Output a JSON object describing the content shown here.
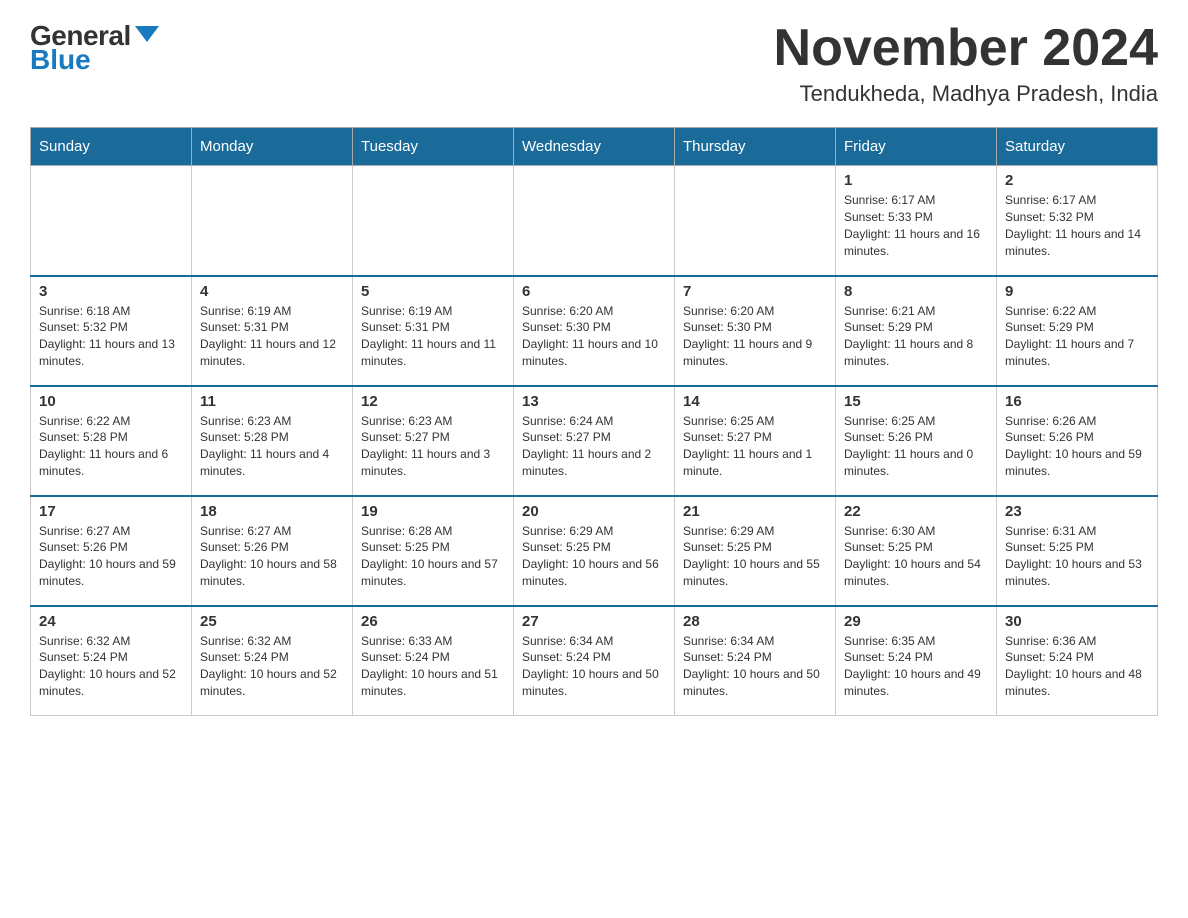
{
  "logo": {
    "general": "General",
    "blue": "Blue"
  },
  "header": {
    "month_year": "November 2024",
    "location": "Tendukheda, Madhya Pradesh, India"
  },
  "weekdays": [
    "Sunday",
    "Monday",
    "Tuesday",
    "Wednesday",
    "Thursday",
    "Friday",
    "Saturday"
  ],
  "weeks": [
    [
      {
        "day": "",
        "sunrise": "",
        "sunset": "",
        "daylight": ""
      },
      {
        "day": "",
        "sunrise": "",
        "sunset": "",
        "daylight": ""
      },
      {
        "day": "",
        "sunrise": "",
        "sunset": "",
        "daylight": ""
      },
      {
        "day": "",
        "sunrise": "",
        "sunset": "",
        "daylight": ""
      },
      {
        "day": "",
        "sunrise": "",
        "sunset": "",
        "daylight": ""
      },
      {
        "day": "1",
        "sunrise": "Sunrise: 6:17 AM",
        "sunset": "Sunset: 5:33 PM",
        "daylight": "Daylight: 11 hours and 16 minutes."
      },
      {
        "day": "2",
        "sunrise": "Sunrise: 6:17 AM",
        "sunset": "Sunset: 5:32 PM",
        "daylight": "Daylight: 11 hours and 14 minutes."
      }
    ],
    [
      {
        "day": "3",
        "sunrise": "Sunrise: 6:18 AM",
        "sunset": "Sunset: 5:32 PM",
        "daylight": "Daylight: 11 hours and 13 minutes."
      },
      {
        "day": "4",
        "sunrise": "Sunrise: 6:19 AM",
        "sunset": "Sunset: 5:31 PM",
        "daylight": "Daylight: 11 hours and 12 minutes."
      },
      {
        "day": "5",
        "sunrise": "Sunrise: 6:19 AM",
        "sunset": "Sunset: 5:31 PM",
        "daylight": "Daylight: 11 hours and 11 minutes."
      },
      {
        "day": "6",
        "sunrise": "Sunrise: 6:20 AM",
        "sunset": "Sunset: 5:30 PM",
        "daylight": "Daylight: 11 hours and 10 minutes."
      },
      {
        "day": "7",
        "sunrise": "Sunrise: 6:20 AM",
        "sunset": "Sunset: 5:30 PM",
        "daylight": "Daylight: 11 hours and 9 minutes."
      },
      {
        "day": "8",
        "sunrise": "Sunrise: 6:21 AM",
        "sunset": "Sunset: 5:29 PM",
        "daylight": "Daylight: 11 hours and 8 minutes."
      },
      {
        "day": "9",
        "sunrise": "Sunrise: 6:22 AM",
        "sunset": "Sunset: 5:29 PM",
        "daylight": "Daylight: 11 hours and 7 minutes."
      }
    ],
    [
      {
        "day": "10",
        "sunrise": "Sunrise: 6:22 AM",
        "sunset": "Sunset: 5:28 PM",
        "daylight": "Daylight: 11 hours and 6 minutes."
      },
      {
        "day": "11",
        "sunrise": "Sunrise: 6:23 AM",
        "sunset": "Sunset: 5:28 PM",
        "daylight": "Daylight: 11 hours and 4 minutes."
      },
      {
        "day": "12",
        "sunrise": "Sunrise: 6:23 AM",
        "sunset": "Sunset: 5:27 PM",
        "daylight": "Daylight: 11 hours and 3 minutes."
      },
      {
        "day": "13",
        "sunrise": "Sunrise: 6:24 AM",
        "sunset": "Sunset: 5:27 PM",
        "daylight": "Daylight: 11 hours and 2 minutes."
      },
      {
        "day": "14",
        "sunrise": "Sunrise: 6:25 AM",
        "sunset": "Sunset: 5:27 PM",
        "daylight": "Daylight: 11 hours and 1 minute."
      },
      {
        "day": "15",
        "sunrise": "Sunrise: 6:25 AM",
        "sunset": "Sunset: 5:26 PM",
        "daylight": "Daylight: 11 hours and 0 minutes."
      },
      {
        "day": "16",
        "sunrise": "Sunrise: 6:26 AM",
        "sunset": "Sunset: 5:26 PM",
        "daylight": "Daylight: 10 hours and 59 minutes."
      }
    ],
    [
      {
        "day": "17",
        "sunrise": "Sunrise: 6:27 AM",
        "sunset": "Sunset: 5:26 PM",
        "daylight": "Daylight: 10 hours and 59 minutes."
      },
      {
        "day": "18",
        "sunrise": "Sunrise: 6:27 AM",
        "sunset": "Sunset: 5:26 PM",
        "daylight": "Daylight: 10 hours and 58 minutes."
      },
      {
        "day": "19",
        "sunrise": "Sunrise: 6:28 AM",
        "sunset": "Sunset: 5:25 PM",
        "daylight": "Daylight: 10 hours and 57 minutes."
      },
      {
        "day": "20",
        "sunrise": "Sunrise: 6:29 AM",
        "sunset": "Sunset: 5:25 PM",
        "daylight": "Daylight: 10 hours and 56 minutes."
      },
      {
        "day": "21",
        "sunrise": "Sunrise: 6:29 AM",
        "sunset": "Sunset: 5:25 PM",
        "daylight": "Daylight: 10 hours and 55 minutes."
      },
      {
        "day": "22",
        "sunrise": "Sunrise: 6:30 AM",
        "sunset": "Sunset: 5:25 PM",
        "daylight": "Daylight: 10 hours and 54 minutes."
      },
      {
        "day": "23",
        "sunrise": "Sunrise: 6:31 AM",
        "sunset": "Sunset: 5:25 PM",
        "daylight": "Daylight: 10 hours and 53 minutes."
      }
    ],
    [
      {
        "day": "24",
        "sunrise": "Sunrise: 6:32 AM",
        "sunset": "Sunset: 5:24 PM",
        "daylight": "Daylight: 10 hours and 52 minutes."
      },
      {
        "day": "25",
        "sunrise": "Sunrise: 6:32 AM",
        "sunset": "Sunset: 5:24 PM",
        "daylight": "Daylight: 10 hours and 52 minutes."
      },
      {
        "day": "26",
        "sunrise": "Sunrise: 6:33 AM",
        "sunset": "Sunset: 5:24 PM",
        "daylight": "Daylight: 10 hours and 51 minutes."
      },
      {
        "day": "27",
        "sunrise": "Sunrise: 6:34 AM",
        "sunset": "Sunset: 5:24 PM",
        "daylight": "Daylight: 10 hours and 50 minutes."
      },
      {
        "day": "28",
        "sunrise": "Sunrise: 6:34 AM",
        "sunset": "Sunset: 5:24 PM",
        "daylight": "Daylight: 10 hours and 50 minutes."
      },
      {
        "day": "29",
        "sunrise": "Sunrise: 6:35 AM",
        "sunset": "Sunset: 5:24 PM",
        "daylight": "Daylight: 10 hours and 49 minutes."
      },
      {
        "day": "30",
        "sunrise": "Sunrise: 6:36 AM",
        "sunset": "Sunset: 5:24 PM",
        "daylight": "Daylight: 10 hours and 48 minutes."
      }
    ]
  ]
}
